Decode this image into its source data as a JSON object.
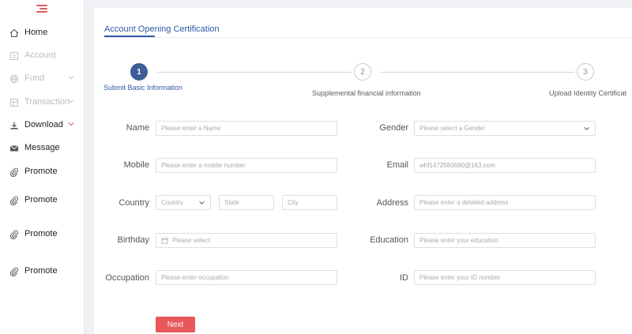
{
  "sidebar": {
    "items": [
      {
        "label": "Home",
        "icon": "home-icon"
      },
      {
        "label": "Account",
        "icon": "account-icon"
      },
      {
        "label": "Fund",
        "icon": "globe-icon"
      },
      {
        "label": "Transaction",
        "icon": "transaction-icon"
      },
      {
        "label": "Download",
        "icon": "download-icon"
      },
      {
        "label": "Message",
        "icon": "mail-icon"
      },
      {
        "label": "Promote",
        "icon": "paperclip-icon"
      },
      {
        "label": "Promote",
        "icon": "paperclip-icon"
      },
      {
        "label": "Promote",
        "icon": "paperclip-icon"
      },
      {
        "label": "Promote",
        "icon": "paperclip-icon"
      }
    ]
  },
  "main": {
    "tab_label": "Account Opening Certification",
    "steps": [
      {
        "number": "1",
        "label": "Submit Basic Information"
      },
      {
        "number": "2",
        "label": "Supplemental financial information"
      },
      {
        "number": "3",
        "label": "Upload Identity Certificat"
      }
    ],
    "form": {
      "name": {
        "label": "Name",
        "placeholder": "Please enter a Name"
      },
      "gender": {
        "label": "Gender",
        "placeholder": "Please select a Gender"
      },
      "mobile": {
        "label": "Mobile",
        "placeholder": "Please enter a mobile number"
      },
      "email": {
        "label": "Email",
        "value": "whf1472583690@163.com"
      },
      "country": {
        "label": "Country",
        "country_placeholder": "Country",
        "state_placeholder": "State",
        "city_placeholder": "City"
      },
      "address": {
        "label": "Address",
        "placeholder": "Please enter a detailed address"
      },
      "birthday": {
        "label": "Birthday",
        "placeholder": "Please select"
      },
      "education": {
        "label": "Education",
        "placeholder": "Please enter your education"
      },
      "occupation": {
        "label": "Occupation",
        "placeholder": "Please enter occupation"
      },
      "id": {
        "label": "ID",
        "placeholder": "Please enter your ID number"
      }
    },
    "next_label": "Next"
  },
  "colors": {
    "accent": "#2f5aa8",
    "step_active": "#3c5d96",
    "brand_red": "#e9575a"
  }
}
